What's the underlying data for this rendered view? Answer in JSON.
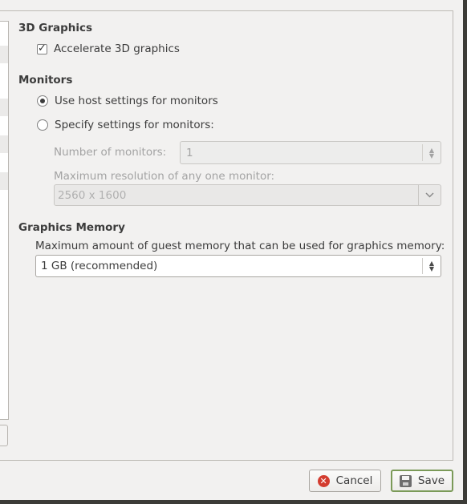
{
  "sections": {
    "graphics_3d": {
      "title": "3D Graphics",
      "accelerate_label": "Accelerate 3D graphics",
      "accelerate_checked": true
    },
    "monitors": {
      "title": "Monitors",
      "use_host_label": "Use host settings for monitors",
      "specify_label": "Specify settings for monitors:",
      "selected": "use_host",
      "number_label": "Number of monitors:",
      "number_value": "1",
      "resolution_label": "Maximum resolution of any one monitor:",
      "resolution_value": "2560 x 1600"
    },
    "graphics_memory": {
      "title": "Graphics Memory",
      "description": "Maximum amount of guest memory that can be used for graphics memory:",
      "value": "1 GB (recommended)"
    }
  },
  "buttons": {
    "cancel": "Cancel",
    "save": "Save"
  },
  "icons": {
    "checkbox": "checkmark-icon",
    "spin_arrows": "up-down-arrows-icon",
    "dropdown": "chevron-down-icon",
    "cancel": "cancel-icon",
    "save": "save-icon"
  },
  "colors": {
    "window_bg": "#f2f1f0",
    "save_border": "#7b9a58",
    "cancel_icon": "#d33c2f"
  }
}
